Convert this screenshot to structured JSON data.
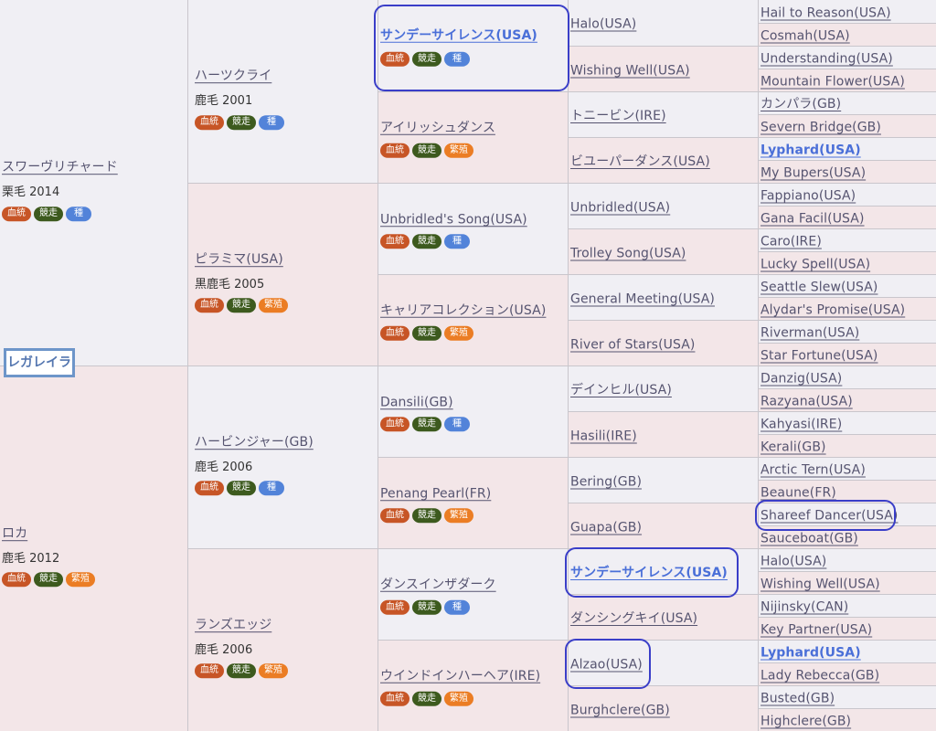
{
  "target_horse": "レガレイラ",
  "badges": {
    "blood": "血統",
    "race": "競走",
    "stud": "種",
    "mare": "繁殖"
  },
  "gen1": [
    {
      "name": "スワーヴリチャード",
      "info": "栗毛 2014",
      "tags": [
        "blood",
        "race",
        "stud"
      ]
    },
    {
      "name": "ロカ",
      "info": "鹿毛 2012",
      "tags": [
        "blood",
        "race",
        "mare"
      ]
    }
  ],
  "gen2": [
    {
      "name": "ハーツクライ",
      "info": "鹿毛 2001",
      "tags": [
        "blood",
        "race",
        "stud"
      ]
    },
    {
      "name": "ピラミマ(USA)",
      "info": "黒鹿毛 2005",
      "tags": [
        "blood",
        "race",
        "mare"
      ]
    },
    {
      "name": "ハービンジャー(GB)",
      "info": "鹿毛 2006",
      "tags": [
        "blood",
        "race",
        "stud"
      ]
    },
    {
      "name": "ランズエッジ",
      "info": "鹿毛 2006",
      "tags": [
        "blood",
        "race",
        "mare"
      ]
    }
  ],
  "gen3": [
    {
      "name": "サンデーサイレンス(USA)",
      "tags": [
        "blood",
        "race",
        "stud"
      ],
      "highlight": true
    },
    {
      "name": "アイリッシュダンス",
      "tags": [
        "blood",
        "race",
        "mare"
      ]
    },
    {
      "name": "Unbridled's Song(USA)",
      "tags": [
        "blood",
        "race",
        "stud"
      ]
    },
    {
      "name": "キャリアコレクション(USA)",
      "tags": [
        "blood",
        "race",
        "mare"
      ]
    },
    {
      "name": "Dansili(GB)",
      "tags": [
        "blood",
        "race",
        "stud"
      ]
    },
    {
      "name": "Penang Pearl(FR)",
      "tags": [
        "blood",
        "race",
        "mare"
      ]
    },
    {
      "name": "ダンスインザダーク",
      "tags": [
        "blood",
        "race",
        "stud"
      ]
    },
    {
      "name": "ウインドインハーヘア(IRE)",
      "tags": [
        "blood",
        "race",
        "mare"
      ]
    }
  ],
  "gen4": [
    {
      "name": "Halo(USA)"
    },
    {
      "name": "Wishing Well(USA)"
    },
    {
      "name": "トニービン(IRE)"
    },
    {
      "name": "ビユーパーダンス(USA)"
    },
    {
      "name": "Unbridled(USA)"
    },
    {
      "name": "Trolley Song(USA)"
    },
    {
      "name": "General Meeting(USA)"
    },
    {
      "name": "River of Stars(USA)"
    },
    {
      "name": "デインヒル(USA)"
    },
    {
      "name": "Hasili(IRE)"
    },
    {
      "name": "Bering(GB)"
    },
    {
      "name": "Guapa(GB)"
    },
    {
      "name": "サンデーサイレンス(USA)",
      "highlight": true
    },
    {
      "name": "ダンシングキイ(USA)"
    },
    {
      "name": "Alzao(USA)"
    },
    {
      "name": "Burghclere(GB)"
    }
  ],
  "gen5": [
    {
      "name": "Hail to Reason(USA)"
    },
    {
      "name": "Cosmah(USA)"
    },
    {
      "name": "Understanding(USA)"
    },
    {
      "name": "Mountain Flower(USA)"
    },
    {
      "name": "カンパラ(GB)"
    },
    {
      "name": "Severn Bridge(GB)"
    },
    {
      "name": "Lyphard(USA)",
      "highlight": true
    },
    {
      "name": "My Bupers(USA)"
    },
    {
      "name": "Fappiano(USA)"
    },
    {
      "name": "Gana Facil(USA)"
    },
    {
      "name": "Caro(IRE)"
    },
    {
      "name": "Lucky Spell(USA)"
    },
    {
      "name": "Seattle Slew(USA)"
    },
    {
      "name": "Alydar's Promise(USA)"
    },
    {
      "name": "Riverman(USA)"
    },
    {
      "name": "Star Fortune(USA)"
    },
    {
      "name": "Danzig(USA)"
    },
    {
      "name": "Razyana(USA)"
    },
    {
      "name": "Kahyasi(IRE)"
    },
    {
      "name": "Kerali(GB)"
    },
    {
      "name": "Arctic Tern(USA)"
    },
    {
      "name": "Beaune(FR)"
    },
    {
      "name": "Shareef Dancer(USA)"
    },
    {
      "name": "Sauceboat(GB)"
    },
    {
      "name": "Halo(USA)"
    },
    {
      "name": "Wishing Well(USA)"
    },
    {
      "name": "Nijinsky(CAN)"
    },
    {
      "name": "Key Partner(USA)"
    },
    {
      "name": "Lyphard(USA)",
      "highlight": true
    },
    {
      "name": "Lady Rebecca(GB)"
    },
    {
      "name": "Busted(GB)"
    },
    {
      "name": "Highclere(GB)"
    }
  ]
}
